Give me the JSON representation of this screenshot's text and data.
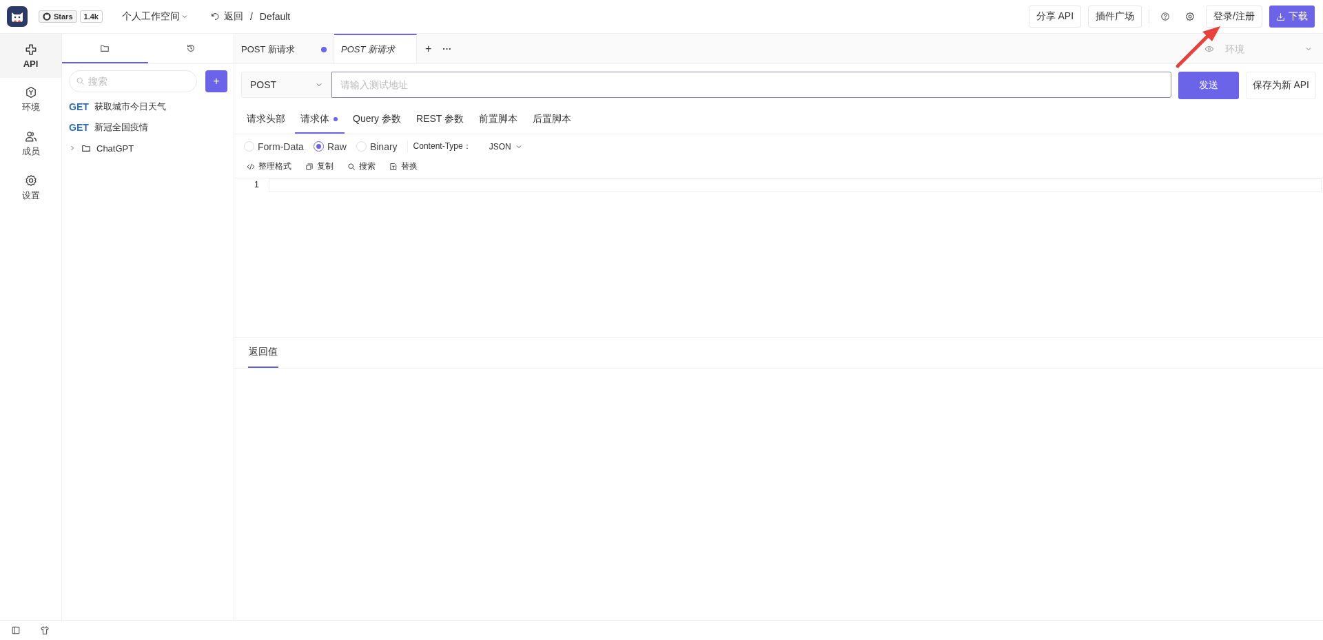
{
  "header": {
    "stars_label": "Stars",
    "stars_count": "1.4k",
    "workspace": "个人工作空间",
    "back": "返回",
    "separator": "/",
    "project": "Default",
    "buttons": [
      "分享 API",
      "插件广场"
    ],
    "login": "登录/注册",
    "download": "下载"
  },
  "rail": [
    {
      "kind": "api",
      "label": "API",
      "selected": true
    },
    {
      "kind": "env",
      "label": "环境",
      "selected": false
    },
    {
      "kind": "members",
      "label": "成员",
      "selected": false
    },
    {
      "kind": "settings",
      "label": "设置",
      "selected": false
    }
  ],
  "sidebar": {
    "tabs": [
      {
        "kind": "folder",
        "selected": true
      },
      {
        "kind": "history",
        "selected": false
      }
    ],
    "search_placeholder": "搜索",
    "add": "+",
    "items": [
      {
        "kind": "api",
        "method": "GET",
        "name": "获取城市今日天气"
      },
      {
        "kind": "api",
        "method": "GET",
        "name": "新冠全国疫情"
      },
      {
        "kind": "folder",
        "name": "ChatGPT",
        "expanded": false
      }
    ]
  },
  "request_tabs": [
    {
      "method": "POST",
      "name": "新请求",
      "selected": false,
      "modified": true
    },
    {
      "method": "POST",
      "name": "新请求",
      "selected": true,
      "modified": false
    }
  ],
  "tab_add": "+",
  "tab_more": "···",
  "environment": {
    "placeholder": "环境"
  },
  "request": {
    "method": "POST",
    "url_placeholder": "请输入测试地址",
    "send": "发送",
    "save": "保存为新 API"
  },
  "param_tabs": [
    {
      "label": "请求头部",
      "selected": false,
      "modified": false
    },
    {
      "label": "请求体",
      "selected": true,
      "modified": true
    },
    {
      "label": "Query 参数",
      "selected": false,
      "modified": false
    },
    {
      "label": "REST 参数",
      "selected": false,
      "modified": false
    },
    {
      "label": "前置脚本",
      "selected": false,
      "modified": false
    },
    {
      "label": "后置脚本",
      "selected": false,
      "modified": false
    }
  ],
  "body_types": [
    {
      "label": "Form-Data",
      "selected": false
    },
    {
      "label": "Raw",
      "selected": true
    },
    {
      "label": "Binary",
      "selected": false
    }
  ],
  "content_type_label": "Content-Type：",
  "content_type": "JSON",
  "editor_tools": [
    {
      "kind": "format",
      "label": "整理格式"
    },
    {
      "kind": "copy",
      "label": "复制"
    },
    {
      "kind": "search",
      "label": "搜索"
    },
    {
      "kind": "replace",
      "label": "替换"
    }
  ],
  "editor": {
    "line_numbers": [
      "1"
    ]
  },
  "response_tabs": [
    {
      "label": "返回值",
      "selected": true
    }
  ]
}
